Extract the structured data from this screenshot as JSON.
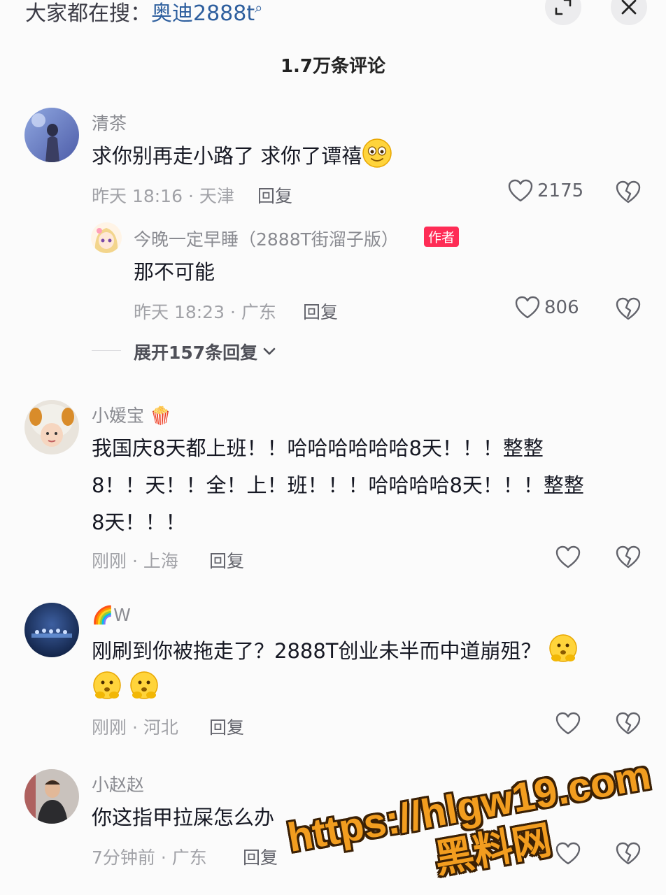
{
  "header": {
    "search_prefix": "大家都在搜：",
    "search_term": "奥迪2888t",
    "comment_count": "1.7万条评论"
  },
  "comments": [
    {
      "username": "清茶",
      "text": "求你别再走小路了 求你了谭禧",
      "time_location": "昨天 18:16 · 天津",
      "reply_label": "回复",
      "likes": "2175",
      "replies": [
        {
          "username": "今晚一定早睡（2888T街溜子版）",
          "badge": "作者",
          "text": "那不可能",
          "time_location": "昨天 18:23 · 广东",
          "reply_label": "回复",
          "likes": "806"
        }
      ],
      "expand_label": "展开157条回复"
    },
    {
      "username": "小媛宝",
      "text_lines": [
        "我国庆8天都上班！！哈哈哈哈哈哈8天！！！整整",
        "8！！天！！全！上！班！！！哈哈哈哈8天！！！整整",
        "8天！！！"
      ],
      "time_location": "刚刚 · 上海",
      "reply_label": "回复"
    },
    {
      "username": "W",
      "text_lines": [
        "刚刷到你被拖走了？2888T创业未半而中道崩殂？"
      ],
      "time_location": "刚刚 · 河北",
      "reply_label": "回复"
    },
    {
      "username": "小赵赵",
      "text": "你这指甲拉屎怎么办",
      "time_location": "7分钟前 · 广东",
      "reply_label": "回复"
    }
  ],
  "watermark": {
    "url": "https://hlgw19.com",
    "name": "黑料网"
  },
  "icons": [
    "expand-icon",
    "close-icon",
    "heart-icon",
    "dislike-icon",
    "chevron-down-icon",
    "search-icon"
  ],
  "colors": {
    "author_badge": "#fe2c55",
    "link": "#2e5f9e",
    "background": "#fbfbfb"
  }
}
